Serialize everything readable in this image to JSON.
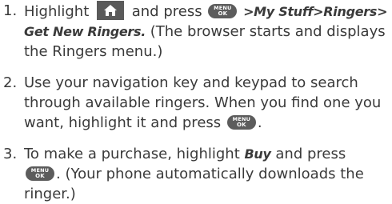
{
  "icons": {
    "home": "home-icon",
    "menu_ok": "menu-ok-key-icon"
  },
  "menu_key": {
    "top": "MENU",
    "bottom": "OK"
  },
  "steps": [
    {
      "number": "1.",
      "t1": "Highlight",
      "t2": "and press",
      "path": ">My Stuff>Ringers>",
      "path2": "Get New Ringers.",
      "t3": "(The browser starts and displays",
      "t4": "the Ringers menu.)"
    },
    {
      "number": "2.",
      "t1": "Use your navigation key and keypad to search",
      "t2": "through available ringers. When you find one you",
      "t3": "want, highlight it and press",
      "t4": "."
    },
    {
      "number": "3.",
      "t1": "To make a purchase, highlight",
      "buy": "Buy",
      "t2": "and press",
      "t3": ". (Your phone automatically downloads the",
      "t4": "ringer.)"
    }
  ]
}
